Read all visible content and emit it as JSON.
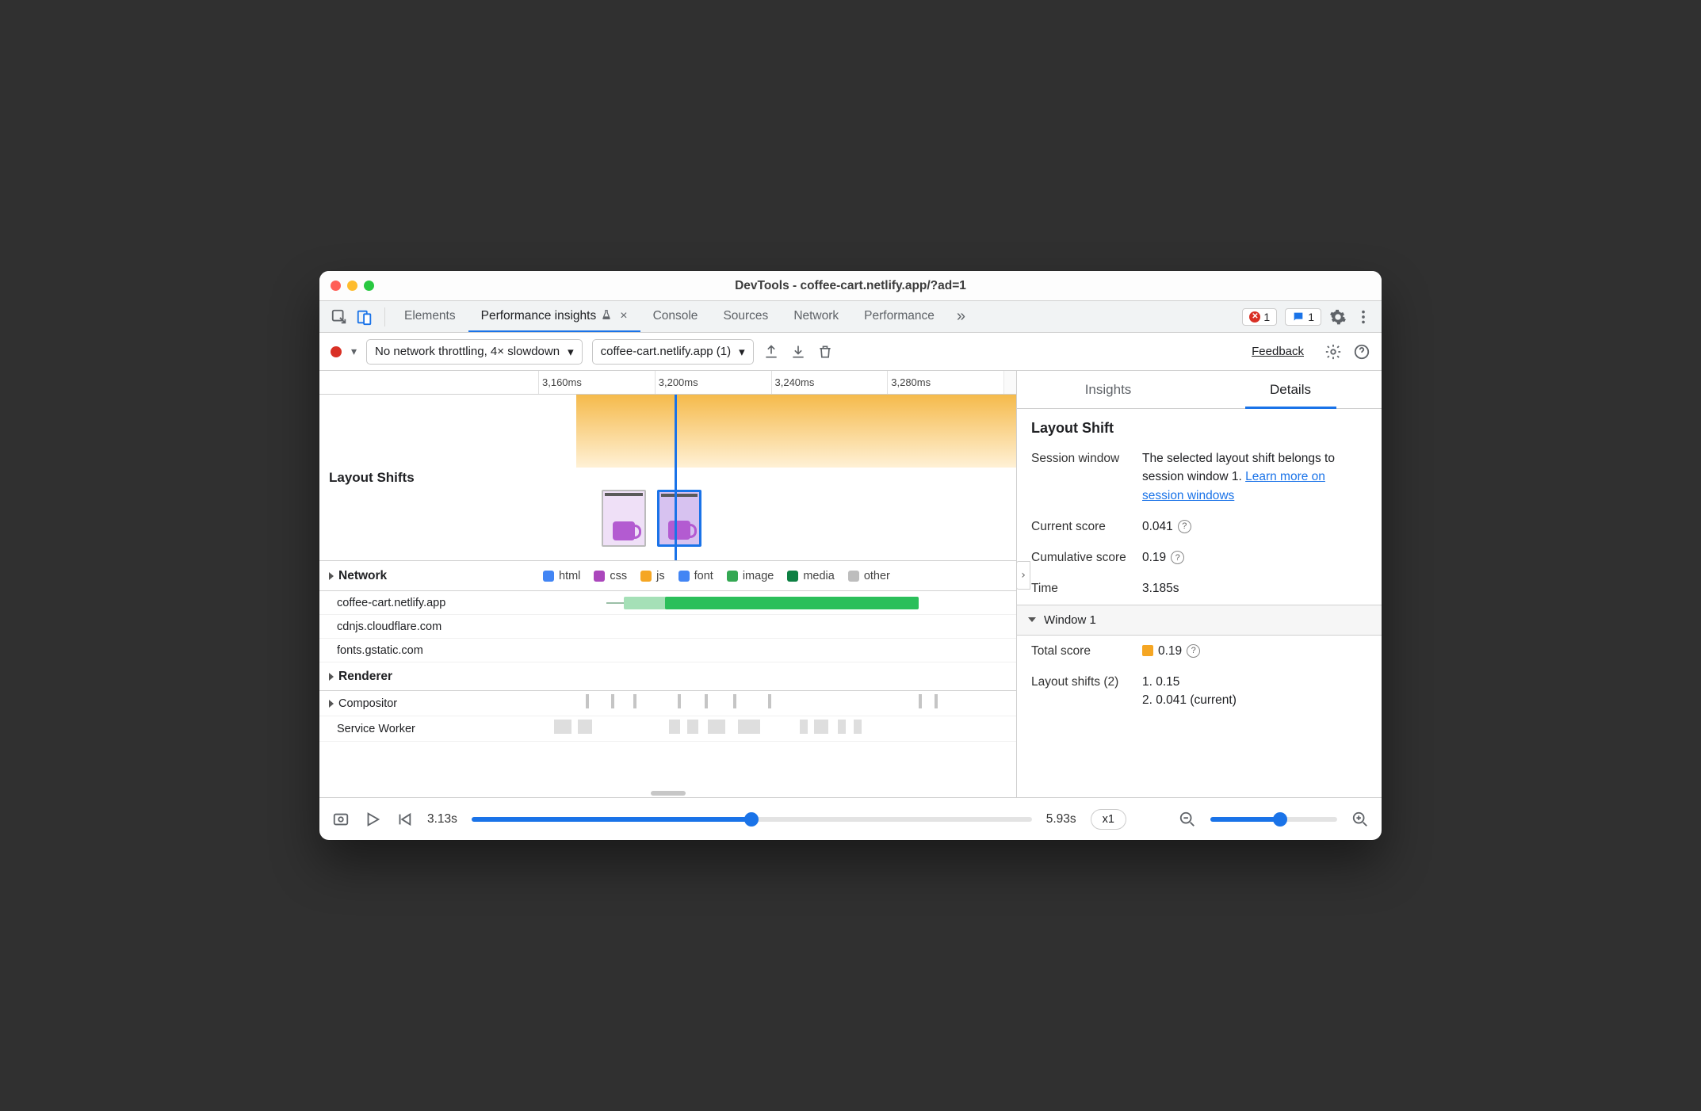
{
  "window_title": "DevTools - coffee-cart.netlify.app/?ad=1",
  "tabs": {
    "items": [
      "Elements",
      "Performance insights",
      "Console",
      "Sources",
      "Network",
      "Performance"
    ],
    "active_index": 1,
    "experiment_flag_on_active": true,
    "error_badge": {
      "count": "1"
    },
    "message_badge": {
      "count": "1"
    }
  },
  "toolbar": {
    "throttle_label": "No network throttling, 4× slowdown",
    "recording_label": "coffee-cart.netlify.app (1)",
    "feedback_label": "Feedback"
  },
  "ruler_ticks": [
    "3,160ms",
    "3,200ms",
    "3,240ms",
    "3,280ms"
  ],
  "layout_shifts": {
    "label": "Layout Shifts"
  },
  "network": {
    "label": "Network",
    "legend": [
      "html",
      "css",
      "js",
      "font",
      "image",
      "media",
      "other"
    ],
    "hosts": [
      "coffee-cart.netlify.app",
      "cdnjs.cloudflare.com",
      "fonts.gstatic.com"
    ]
  },
  "renderer": {
    "label": "Renderer",
    "rows": [
      "Compositor",
      "Service Worker"
    ]
  },
  "details": {
    "tabs": [
      "Insights",
      "Details"
    ],
    "active_index": 1,
    "title": "Layout Shift",
    "session_window": {
      "label": "Session window",
      "text_before_link": "The selected layout shift belongs to session window 1. ",
      "link_text": "Learn more on session windows"
    },
    "rows": [
      {
        "k": "Current score",
        "v": "0.041",
        "help": true
      },
      {
        "k": "Cumulative score",
        "v": "0.19",
        "help": true
      },
      {
        "k": "Time",
        "v": "3.185s",
        "help": false
      }
    ],
    "window": {
      "header": "Window 1",
      "total_score_label": "Total score",
      "total_score": "0.19",
      "shifts_label": "Layout shifts (2)",
      "shifts": [
        "1. 0.15",
        "2. 0.041 (current)"
      ]
    }
  },
  "playback": {
    "start_time": "3.13s",
    "end_time": "5.93s",
    "speed": "x1"
  }
}
